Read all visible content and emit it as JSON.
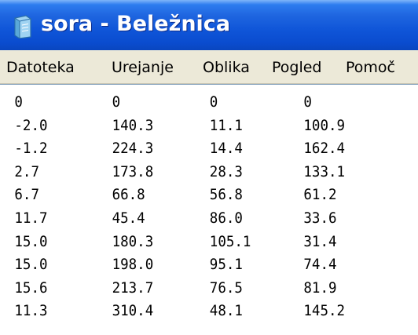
{
  "window": {
    "title": "sora - Beležnica"
  },
  "menu": {
    "items": [
      "Datoteka",
      "Urejanje",
      "Oblika",
      "Pogled",
      "Pomoč"
    ]
  },
  "document": {
    "rows": [
      [
        "0",
        "0",
        "0",
        "0"
      ],
      [
        "-2.0",
        "140.3",
        "11.1",
        "100.9"
      ],
      [
        "-1.2",
        "224.3",
        "14.4",
        "162.4"
      ],
      [
        "2.7",
        "173.8",
        "28.3",
        "133.1"
      ],
      [
        "6.7",
        "66.8",
        "56.8",
        "61.2"
      ],
      [
        "11.7",
        "45.4",
        "86.0",
        "33.6"
      ],
      [
        "15.0",
        "180.3",
        "105.1",
        "31.4"
      ],
      [
        "15.0",
        "198.0",
        "95.1",
        "74.4"
      ],
      [
        "15.6",
        "213.7",
        "76.5",
        "81.9"
      ],
      [
        "11.3",
        "310.4",
        "48.1",
        "145.2"
      ]
    ]
  }
}
